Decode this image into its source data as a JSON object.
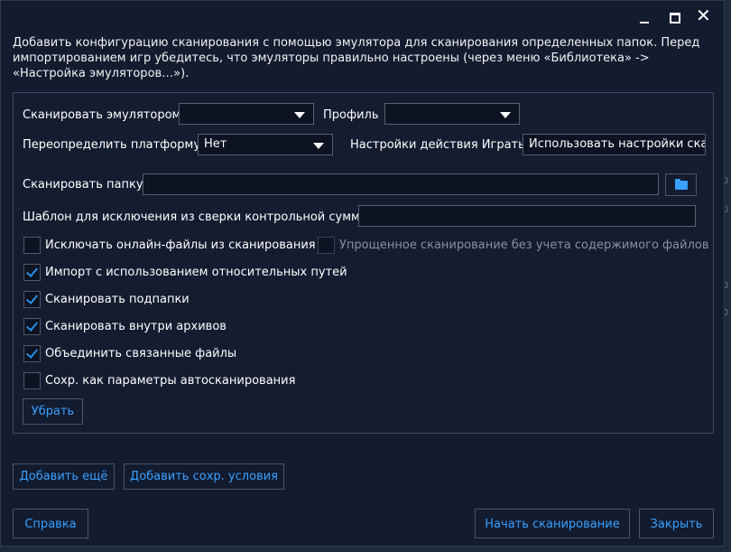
{
  "window": {
    "minimize_icon": "minimize-icon",
    "maximize_icon": "maximize-icon",
    "close_icon": "close-icon",
    "close_glyph": "✕"
  },
  "intro_text": "Добавить конфигурацию сканирования с помощью эмулятора для сканирования определенных папок. Перед импортированием игр убедитесь, что эмуляторы правильно настроены (через меню «Библиотека» -> «Настройка эмуляторов…»).",
  "form": {
    "emulator_label": "Сканировать эмулятором",
    "emulator_value": "",
    "profile_label": "Профиль",
    "profile_value": "",
    "platform_label": "Переопределить платформу",
    "platform_value": "Нет",
    "play_action_label": "Настройки действия Играть",
    "play_action_value": "Использовать настройки скан",
    "folder_label": "Сканировать папку",
    "folder_value": "",
    "folder_icon": "folder-open-icon",
    "exclusion_label": "Шаблон для исключения из сверки контрольной суммы",
    "exclusion_value": ""
  },
  "options": {
    "exclude_online": {
      "label": "Исключать онлайн-файлы из сканирования",
      "checked": false
    },
    "simple_scan": {
      "label": "Упрощенное сканирование без учета содержимого файлов",
      "checked": false,
      "disabled": true
    },
    "relative_paths": {
      "label": "Импорт с использованием относительных путей",
      "checked": true
    },
    "subfolders": {
      "label": "Сканировать подпапки",
      "checked": true
    },
    "archives": {
      "label": "Сканировать внутри архивов",
      "checked": true
    },
    "merge_files": {
      "label": "Объединить связанные файлы",
      "checked": true
    },
    "save_autoscan": {
      "label": "Сохр. как параметры автосканирования",
      "checked": false
    }
  },
  "buttons": {
    "remove": "Убрать",
    "add_more": "Добавить ещё",
    "add_saved": "Добавить сохр. условия",
    "help": "Справка",
    "start_scan": "Начать сканирование",
    "close": "Закрыть"
  },
  "colors": {
    "accent": "#3aa0ff",
    "dialog_bg": "#131b2f",
    "checkmark": "#2b8fe6"
  }
}
